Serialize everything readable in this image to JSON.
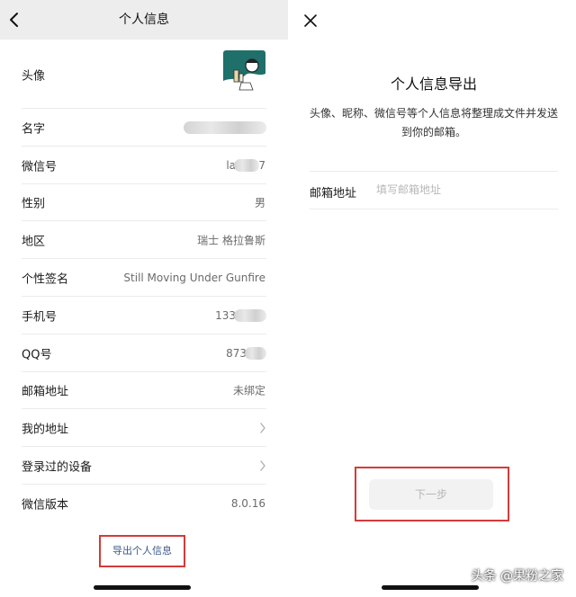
{
  "left": {
    "title": "个人信息",
    "rows": [
      {
        "label": "头像"
      },
      {
        "label": "名字"
      },
      {
        "label": "微信号",
        "value_visible_start": "la",
        "value_visible_end": "7"
      },
      {
        "label": "性别",
        "value": "男"
      },
      {
        "label": "地区",
        "value": "瑞士 格拉鲁斯"
      },
      {
        "label": "个性签名",
        "value": "Still Moving Under Gunfire"
      },
      {
        "label": "手机号",
        "value_visible_start": "133"
      },
      {
        "label": "QQ号",
        "value_visible_start": "873"
      },
      {
        "label": "邮箱地址",
        "value": "未绑定"
      },
      {
        "label": "我的地址"
      },
      {
        "label": "登录过的设备"
      },
      {
        "label": "微信版本",
        "value": "8.0.16"
      }
    ],
    "export_link": "导出个人信息"
  },
  "right": {
    "title": "个人信息导出",
    "description": "头像、昵称、微信号等个人信息将整理成文件并发送到你的邮箱。",
    "email_label": "邮箱地址",
    "email_placeholder": "填写邮箱地址",
    "email_value": "",
    "next_button": "下一步"
  },
  "watermark": "头条 @果粉之家",
  "colors": {
    "highlight_box": "#d43a3a",
    "link": "#3d5a8a",
    "navbar_bg": "#ededed",
    "avatar_teal": "#1f6f6a"
  },
  "icons": {
    "back": "chevron-left-icon",
    "close": "close-icon",
    "row_arrow": "chevron-right-icon"
  }
}
